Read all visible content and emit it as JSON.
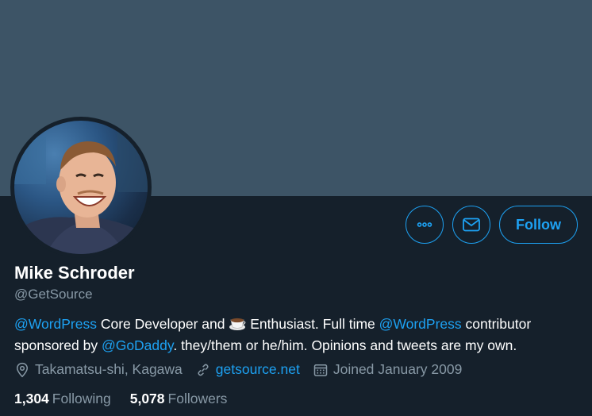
{
  "colors": {
    "banner": "#3d5466",
    "background": "#15202b",
    "accent": "#1da1f2",
    "secondary_text": "#8899a6",
    "primary_text": "#ffffff"
  },
  "profile": {
    "name": "Mike Schroder",
    "handle": "@GetSource",
    "avatar_icon": "profile-photo"
  },
  "actions": {
    "more_icon": "more-horizontal-icon",
    "message_icon": "envelope-icon",
    "follow_label": "Follow"
  },
  "bio": {
    "mention1": "@WordPress",
    "text1": " Core Developer and ",
    "emoji_icon": "coffee-icon",
    "text2": " Enthusiast. Full time ",
    "mention2": "@WordPress",
    "text3": " contributor sponsored by ",
    "mention3": "@GoDaddy",
    "text4": ". they/them or he/him. Opinions and tweets are my own."
  },
  "meta": {
    "location": "Takamatsu-shi, Kagawa",
    "website": "getsource.net",
    "joined": "Joined January 2009"
  },
  "stats": {
    "following_count": "1,304",
    "following_label": "Following",
    "followers_count": "5,078",
    "followers_label": "Followers"
  }
}
